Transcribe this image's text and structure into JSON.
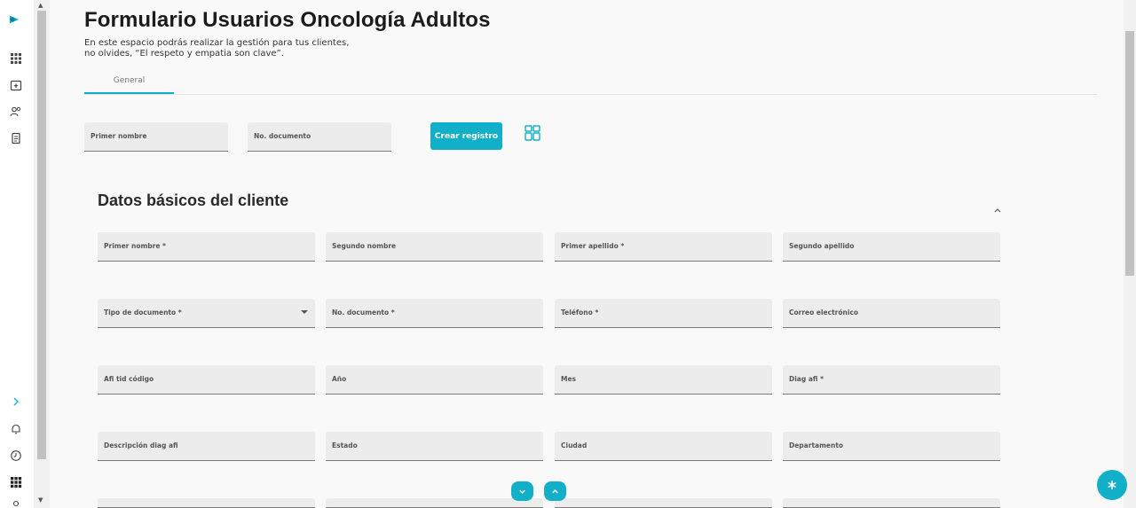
{
  "icons": {
    "logo": "logo-icon",
    "rail": [
      "apps-icon",
      "calendar-add-icon",
      "users-icon",
      "document-icon",
      "chevron-right-icon",
      "bell-icon",
      "clock-icon",
      "grid-icon",
      "user-icon"
    ],
    "layout": "layout-grid-icon",
    "collapse": "chevron-up-icon",
    "scroll_down": "chevron-down-icon",
    "scroll_up": "chevron-up-icon",
    "fab": "asterisk-icon"
  },
  "colors": {
    "accent": "#12b0c8",
    "field_bg": "#ececec"
  },
  "header": {
    "title": "Formulario Usuarios Oncología Adultos",
    "subtitle": "En este espacio podrás realizar la gestión para tus clientes, no olvides, “El respeto y empatia son clave”."
  },
  "tabs": [
    {
      "label": "General"
    }
  ],
  "search": {
    "first_name_label": "Primer nombre",
    "document_label": "No. documento",
    "create_button": "Crear registro"
  },
  "section": {
    "title": "Datos básicos del cliente",
    "fields": [
      [
        "Primer nombre *",
        "Segundo nombre",
        "Primer apellido *",
        "Segundo apellido"
      ],
      [
        "Tipo de documento *",
        "No. documento *",
        "Teléfono *",
        "Correo electrónico"
      ],
      [
        "Afi tid código",
        "Año",
        "Mes",
        "Diag afi *"
      ],
      [
        "Descripción diag afi",
        "Estado",
        "Ciudad",
        "Departamento"
      ]
    ]
  }
}
